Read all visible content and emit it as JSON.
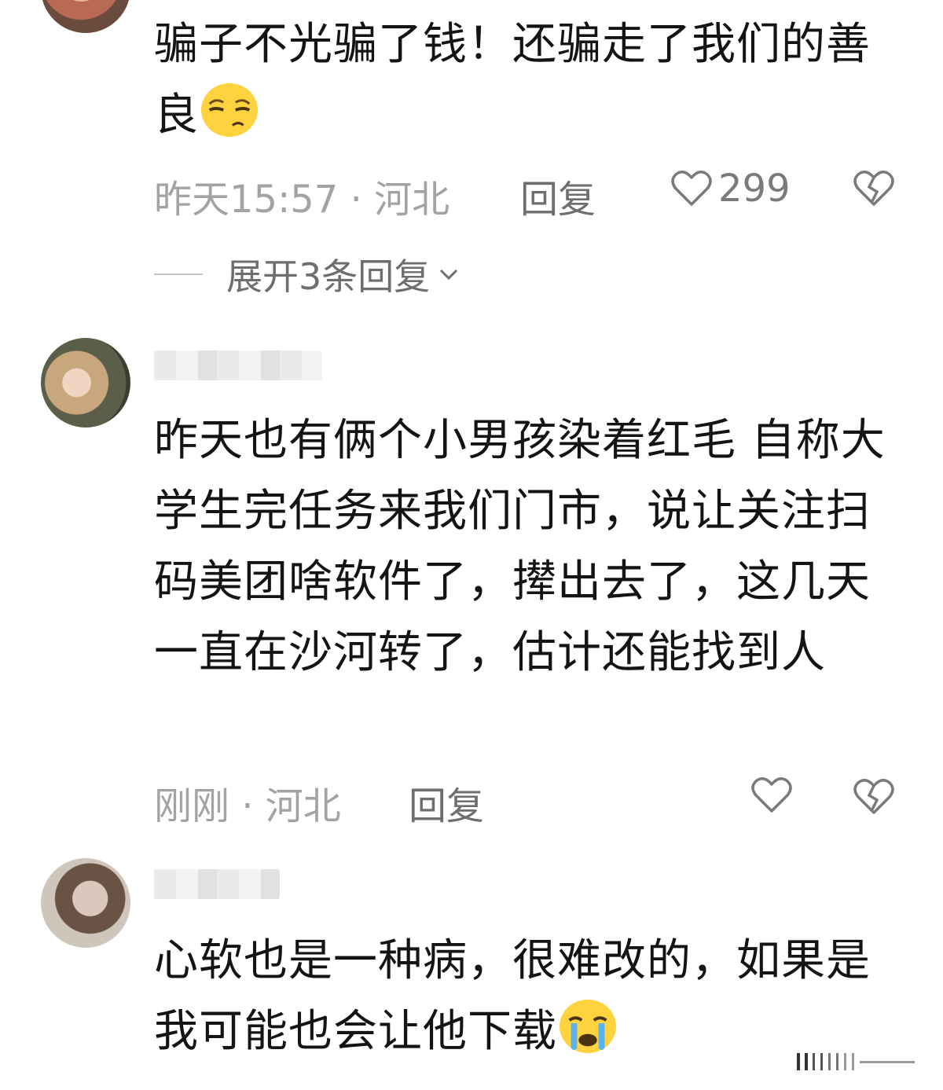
{
  "comments": [
    {
      "text": "骗子不光骗了钱！还骗走了我们的善良",
      "emoji": "smirk-emoji",
      "meta": "昨天15:57 · 河北",
      "reply_label": "回复",
      "like_count": "299",
      "expand_label": "展开3条回复"
    },
    {
      "text": "昨天也有俩个小男孩染着红毛 自称大学生完任务来我们门市，说让关注扫码美团啥软件了，撵出去了，这几天一直在沙河转了，估计还能找到人",
      "meta": "刚刚 · 河北",
      "reply_label": "回复",
      "like_count": ""
    },
    {
      "text": "心软也是一种病，很难改的，如果是我可能也会让他下载",
      "emoji": "crying-emoji"
    }
  ],
  "colors": {
    "text": "#141414",
    "meta": "#a3a3a3",
    "action": "#6e6e6e",
    "icon": "#7a7a7a"
  }
}
